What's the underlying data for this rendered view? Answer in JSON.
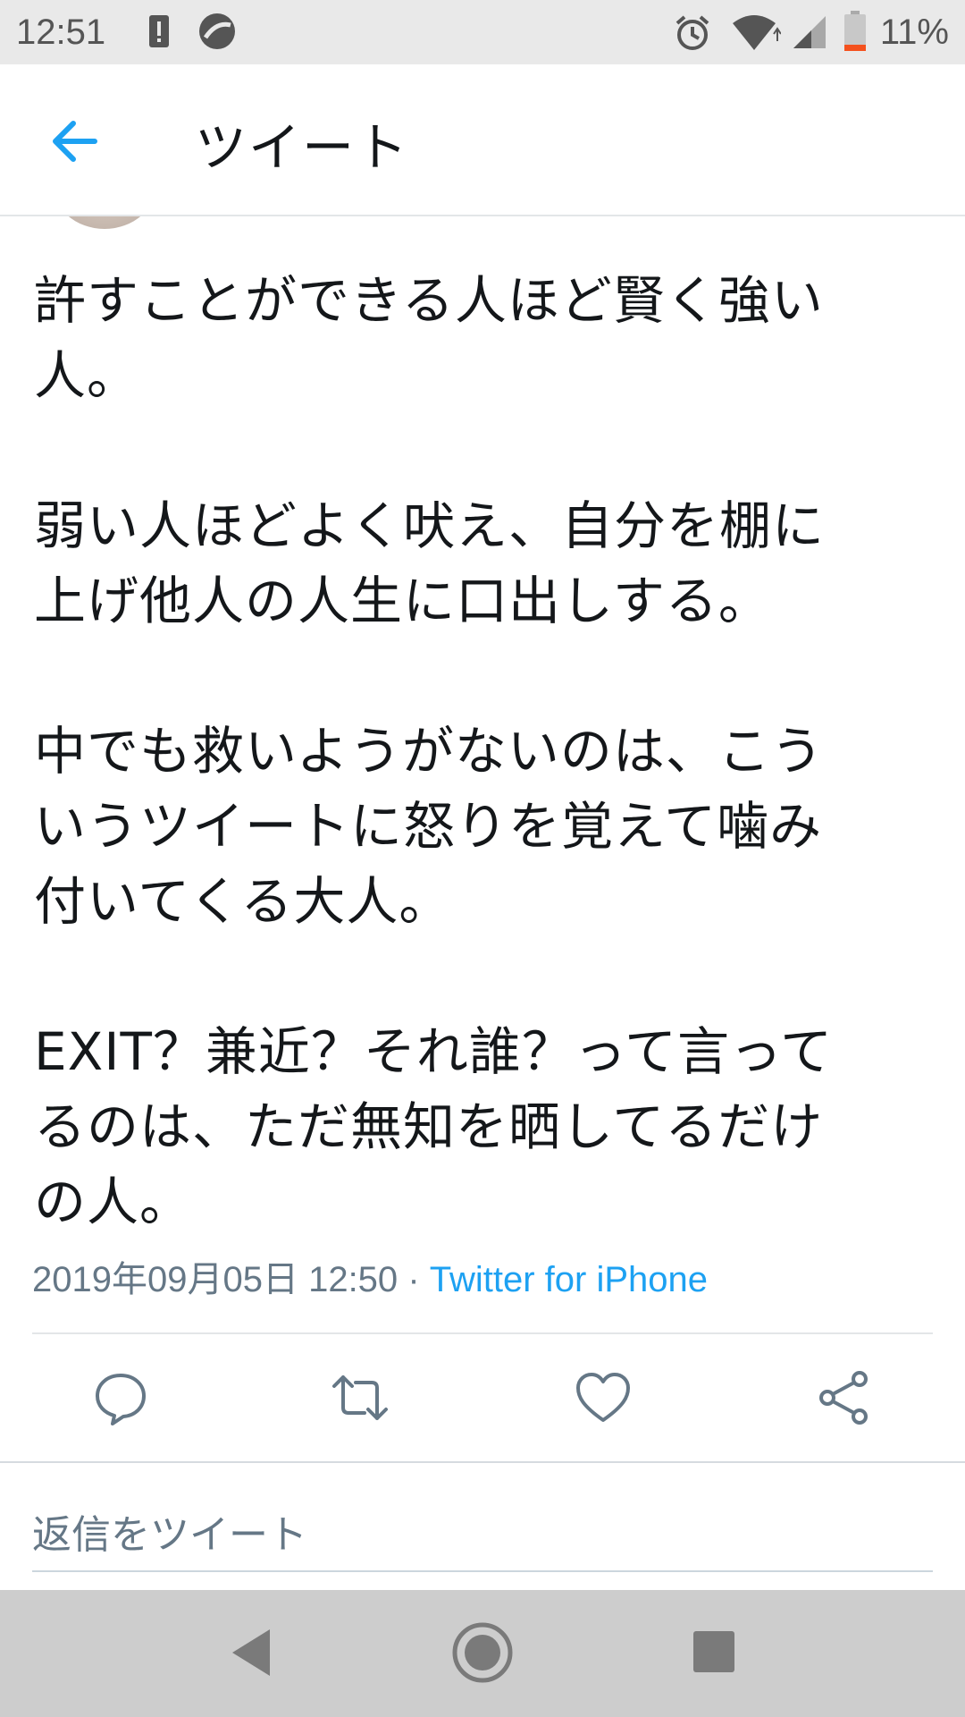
{
  "status_bar": {
    "time": "12:51",
    "battery_percent": "11%",
    "icons": [
      "alert-icon",
      "app-notification-icon",
      "alarm-icon",
      "wifi-icon",
      "signal-icon",
      "battery-icon"
    ]
  },
  "header": {
    "back_icon": "back-arrow-icon",
    "title": "ツイート"
  },
  "tweet": {
    "paragraphs": [
      "許すことができる人ほど賢く強い\n人。",
      "弱い人ほどよく吠え、自分を棚に\n上げ他人の人生に口出しする。",
      "中でも救いようがないのは、こう\nいうツイートに怒りを覚えて噛み\n付いてくる大人。",
      "EXIT？兼近？それ誰？って言って\nるのは、ただ無知を晒してるだけ\nの人。"
    ],
    "timestamp": "2019年09月05日 12:50",
    "separator": "·",
    "source": "Twitter for iPhone"
  },
  "actions": [
    "reply-icon",
    "retweet-icon",
    "like-icon",
    "share-icon"
  ],
  "reply": {
    "placeholder": "返信をツイート"
  },
  "nav": [
    "back-icon",
    "home-icon",
    "recents-icon"
  ],
  "colors": {
    "accent": "#1da1f2",
    "secondary_text": "#657786",
    "status_bar_bg": "#e9e9e9",
    "nav_bar_bg": "#cdcdcd",
    "battery_low": "#f4511e"
  }
}
